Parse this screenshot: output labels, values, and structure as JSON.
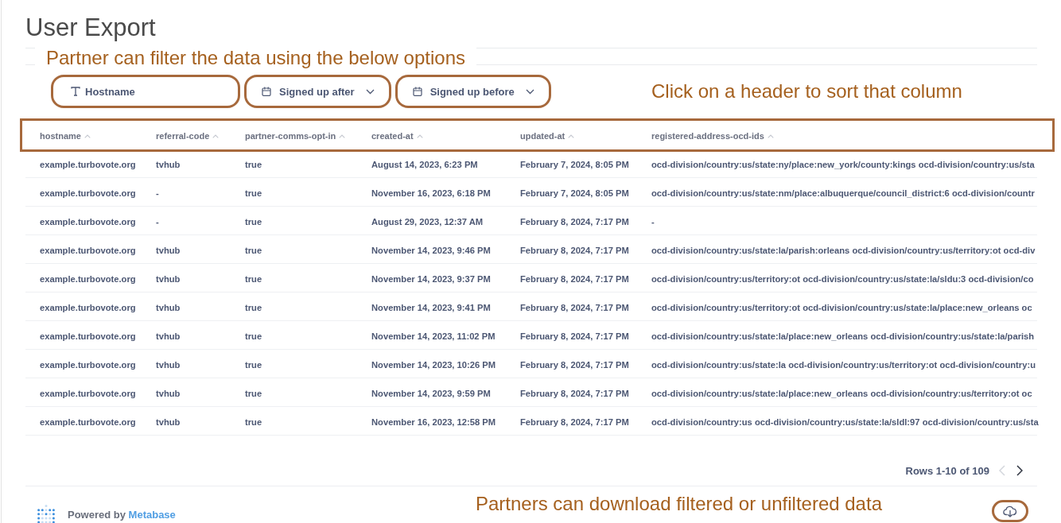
{
  "page": {
    "title": "User Export"
  },
  "annotations": [
    {
      "kind": "filters",
      "text": "Partner can filter the data using the below options"
    },
    {
      "kind": "sort",
      "text": "Click on a header to sort that column"
    },
    {
      "kind": "download",
      "text": "Partners can download filtered or unfiltered data"
    }
  ],
  "filters": [
    {
      "kind": "text",
      "placeholder": "Hostname",
      "highlighted": true
    },
    {
      "kind": "date",
      "label": "Signed up after",
      "highlighted": true
    },
    {
      "kind": "date",
      "label": "Signed up before",
      "highlighted": true
    }
  ],
  "table": {
    "header_highlighted": true,
    "columns": [
      "hostname",
      "referral-code",
      "partner-comms-opt-in",
      "created-at",
      "updated-at",
      "registered-address-ocd-ids"
    ],
    "rows": [
      [
        "example.turbovote.org",
        "tvhub",
        "true",
        "August 14, 2023, 6:23 PM",
        "February 7, 2024, 8:05 PM",
        "ocd-division/country:us/state:ny/place:new_york/county:kings ocd-division/country:us/sta"
      ],
      [
        "example.turbovote.org",
        "-",
        "true",
        "November 16, 2023, 6:18 PM",
        "February 7, 2024, 8:05 PM",
        "ocd-division/country:us/state:nm/place:albuquerque/council_district:6 ocd-division/countr"
      ],
      [
        "example.turbovote.org",
        "-",
        "true",
        "August 29, 2023, 12:37 AM",
        "February 8, 2024, 7:17 PM",
        "-"
      ],
      [
        "example.turbovote.org",
        "tvhub",
        "true",
        "November 14, 2023, 9:46 PM",
        "February 8, 2024, 7:17 PM",
        "ocd-division/country:us/state:la/parish:orleans ocd-division/country:us/territory:ot ocd-div"
      ],
      [
        "example.turbovote.org",
        "tvhub",
        "true",
        "November 14, 2023, 9:37 PM",
        "February 8, 2024, 7:17 PM",
        "ocd-division/country:us/territory:ot ocd-division/country:us/state:la/sldu:3 ocd-division/co"
      ],
      [
        "example.turbovote.org",
        "tvhub",
        "true",
        "November 14, 2023, 9:41 PM",
        "February 8, 2024, 7:17 PM",
        "ocd-division/country:us/territory:ot ocd-division/country:us/state:la/place:new_orleans oc"
      ],
      [
        "example.turbovote.org",
        "tvhub",
        "true",
        "November 14, 2023, 11:02 PM",
        "February 8, 2024, 7:17 PM",
        "ocd-division/country:us/state:la/place:new_orleans ocd-division/country:us/state:la/parish"
      ],
      [
        "example.turbovote.org",
        "tvhub",
        "true",
        "November 14, 2023, 10:26 PM",
        "February 8, 2024, 7:17 PM",
        "ocd-division/country:us/state:la ocd-division/country:us/territory:ot ocd-division/country:u"
      ],
      [
        "example.turbovote.org",
        "tvhub",
        "true",
        "November 14, 2023, 9:59 PM",
        "February 8, 2024, 7:17 PM",
        "ocd-division/country:us/state:la/place:new_orleans ocd-division/country:us/territory:ot oc"
      ],
      [
        "example.turbovote.org",
        "tvhub",
        "true",
        "November 16, 2023, 12:58 PM",
        "February 8, 2024, 7:17 PM",
        "ocd-division/country:us ocd-division/country:us/state:la/sldl:97 ocd-division/country:us/sta"
      ]
    ]
  },
  "pagination": {
    "label": "Rows 1-10 of 109",
    "previous_disabled": true,
    "next_disabled": false
  },
  "footer": {
    "powered_by": "Powered by",
    "link": "Metabase",
    "download_highlighted": true
  }
}
